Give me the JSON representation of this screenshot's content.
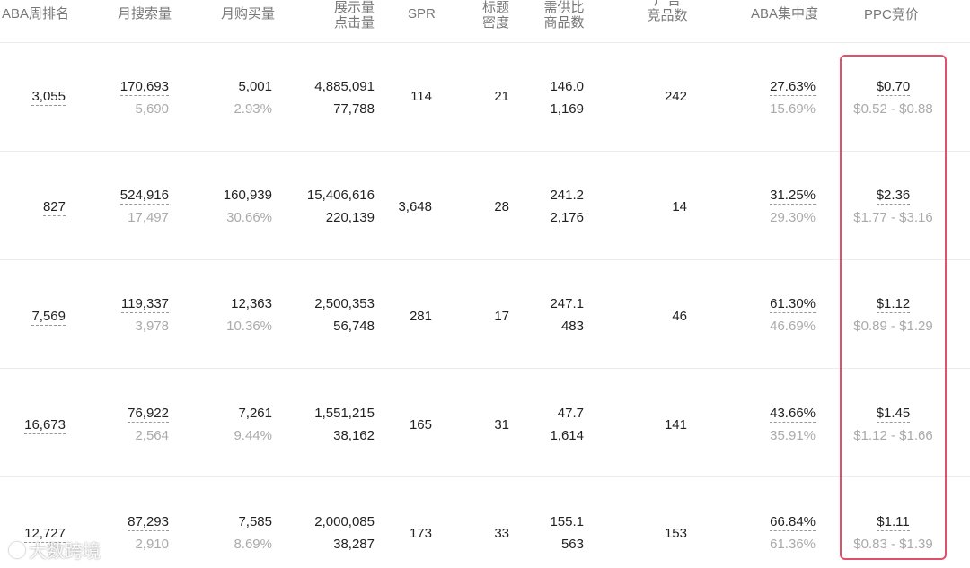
{
  "headers": {
    "aba_rank": "ABA周排名",
    "monthly_search": "月搜索量",
    "monthly_purchase": "月购买量",
    "impressions_line1": "展示量",
    "impressions_line2": "点击量",
    "spr": "SPR",
    "title_density_line1": "标题",
    "title_density_line2": "密度",
    "supply_demand_line1": "需供比",
    "supply_demand_line2": "商品数",
    "ad_products_line1": "广告",
    "ad_products_line2": "竞品数",
    "aba_concentration": "ABA集中度",
    "ppc": "PPC竞价"
  },
  "rows": [
    {
      "rank": "3,055",
      "search": "170,693",
      "search_sub": "5,690",
      "purchase": "5,001",
      "purchase_sub": "2.93%",
      "impressions": "4,885,091",
      "clicks": "77,788",
      "spr": "114",
      "title_density": "21",
      "supply_ratio": "146.0",
      "products": "1,169",
      "ad_products": "242",
      "concentration": "27.63%",
      "concentration_sub": "15.69%",
      "ppc": "$0.70",
      "ppc_range": "$0.52 - $0.88"
    },
    {
      "rank": "827",
      "search": "524,916",
      "search_sub": "17,497",
      "purchase": "160,939",
      "purchase_sub": "30.66%",
      "impressions": "15,406,616",
      "clicks": "220,139",
      "spr": "3,648",
      "title_density": "28",
      "supply_ratio": "241.2",
      "products": "2,176",
      "ad_products": "14",
      "concentration": "31.25%",
      "concentration_sub": "29.30%",
      "ppc": "$2.36",
      "ppc_range": "$1.77 - $3.16"
    },
    {
      "rank": "7,569",
      "search": "119,337",
      "search_sub": "3,978",
      "purchase": "12,363",
      "purchase_sub": "10.36%",
      "impressions": "2,500,353",
      "clicks": "56,748",
      "spr": "281",
      "title_density": "17",
      "supply_ratio": "247.1",
      "products": "483",
      "ad_products": "46",
      "concentration": "61.30%",
      "concentration_sub": "46.69%",
      "ppc": "$1.12",
      "ppc_range": "$0.89 - $1.29"
    },
    {
      "rank": "16,673",
      "search": "76,922",
      "search_sub": "2,564",
      "purchase": "7,261",
      "purchase_sub": "9.44%",
      "impressions": "1,551,215",
      "clicks": "38,162",
      "spr": "165",
      "title_density": "31",
      "supply_ratio": "47.7",
      "products": "1,614",
      "ad_products": "141",
      "concentration": "43.66%",
      "concentration_sub": "35.91%",
      "ppc": "$1.45",
      "ppc_range": "$1.12 - $1.66"
    },
    {
      "rank": "12,727",
      "search": "87,293",
      "search_sub": "2,910",
      "purchase": "7,585",
      "purchase_sub": "8.69%",
      "impressions": "2,000,085",
      "clicks": "38,287",
      "spr": "173",
      "title_density": "33",
      "supply_ratio": "155.1",
      "products": "563",
      "ad_products": "153",
      "concentration": "66.84%",
      "concentration_sub": "61.36%",
      "ppc": "$1.11",
      "ppc_range": "$0.83 - $1.39"
    }
  ],
  "watermark": {
    "text": "大数跨境",
    "icon": "brand-logo-icon"
  },
  "colors": {
    "highlight": "#e0506a",
    "muted": "#aaaaaa",
    "text": "#222222"
  }
}
